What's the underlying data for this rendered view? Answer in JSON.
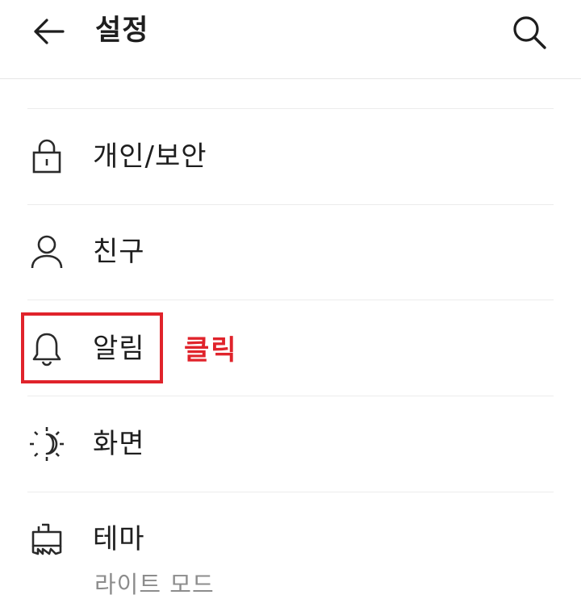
{
  "header": {
    "title": "설정",
    "back_icon": "arrow-left-icon",
    "search_icon": "search-icon"
  },
  "clipped_item_label": "· · ·",
  "menu": [
    {
      "label": "개인/보안",
      "icon": "lock-icon",
      "sub": ""
    },
    {
      "label": "친구",
      "icon": "person-icon",
      "sub": ""
    },
    {
      "label": "알림",
      "icon": "bell-icon",
      "sub": ""
    },
    {
      "label": "화면",
      "icon": "brightness-icon",
      "sub": ""
    },
    {
      "label": "테마",
      "icon": "theme-brush-icon",
      "sub": "라이트 모드"
    }
  ],
  "annotation": {
    "text": "클릭",
    "color": "#e0232b"
  }
}
